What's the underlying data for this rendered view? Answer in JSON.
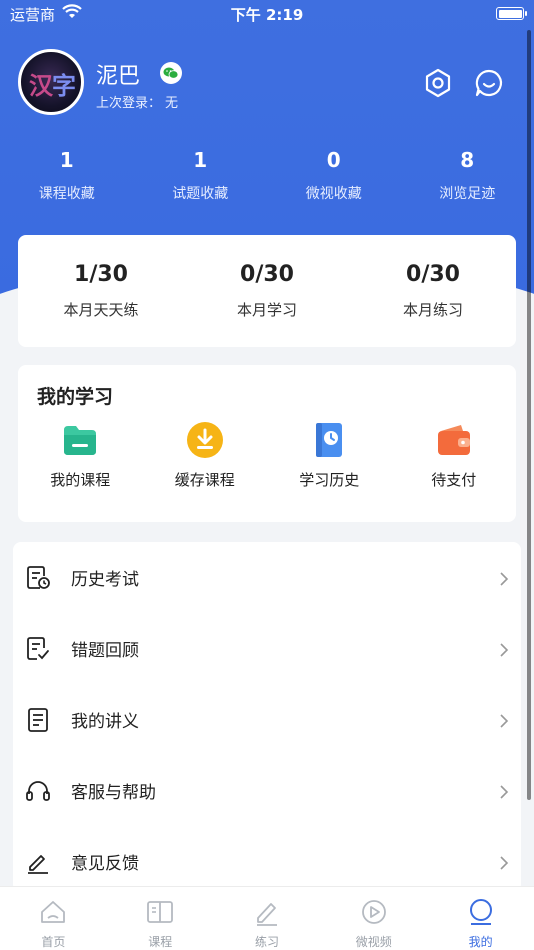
{
  "status_bar": {
    "carrier": "运营商",
    "time": "下午 2:19"
  },
  "profile": {
    "avatar_glyphs": [
      "汉",
      "字"
    ],
    "username": "泥巴",
    "last_login_label": "上次登录：",
    "last_login_value": "无"
  },
  "stats": [
    {
      "value": "1",
      "label": "课程收藏"
    },
    {
      "value": "1",
      "label": "试题收藏"
    },
    {
      "value": "0",
      "label": "微视收藏"
    },
    {
      "value": "8",
      "label": "浏览足迹"
    }
  ],
  "monthly": [
    {
      "value": "1/30",
      "label": "本月天天练"
    },
    {
      "value": "0/30",
      "label": "本月学习"
    },
    {
      "value": "0/30",
      "label": "本月练习"
    }
  ],
  "my_study": {
    "title": "我的学习",
    "items": [
      {
        "label": "我的课程",
        "icon": "folder-icon"
      },
      {
        "label": "缓存课程",
        "icon": "download-icon"
      },
      {
        "label": "学习历史",
        "icon": "clock-book-icon"
      },
      {
        "label": "待支付",
        "icon": "wallet-icon"
      }
    ]
  },
  "menu": [
    {
      "label": "历史考试",
      "icon": "exam-history-icon"
    },
    {
      "label": "错题回顾",
      "icon": "wrong-question-icon"
    },
    {
      "label": "我的讲义",
      "icon": "notes-icon"
    },
    {
      "label": "客服与帮助",
      "icon": "headset-icon"
    },
    {
      "label": "意见反馈",
      "icon": "feedback-pen-icon"
    }
  ],
  "tabs": [
    {
      "label": "首页",
      "icon": "home-icon",
      "active": false
    },
    {
      "label": "课程",
      "icon": "book-icon",
      "active": false
    },
    {
      "label": "练习",
      "icon": "pencil-icon",
      "active": false
    },
    {
      "label": "微视频",
      "icon": "play-icon",
      "active": false
    },
    {
      "label": "我的",
      "icon": "profile-icon",
      "active": true
    }
  ],
  "colors": {
    "primary": "#3b6de0",
    "bg": "#f2f4f7"
  }
}
